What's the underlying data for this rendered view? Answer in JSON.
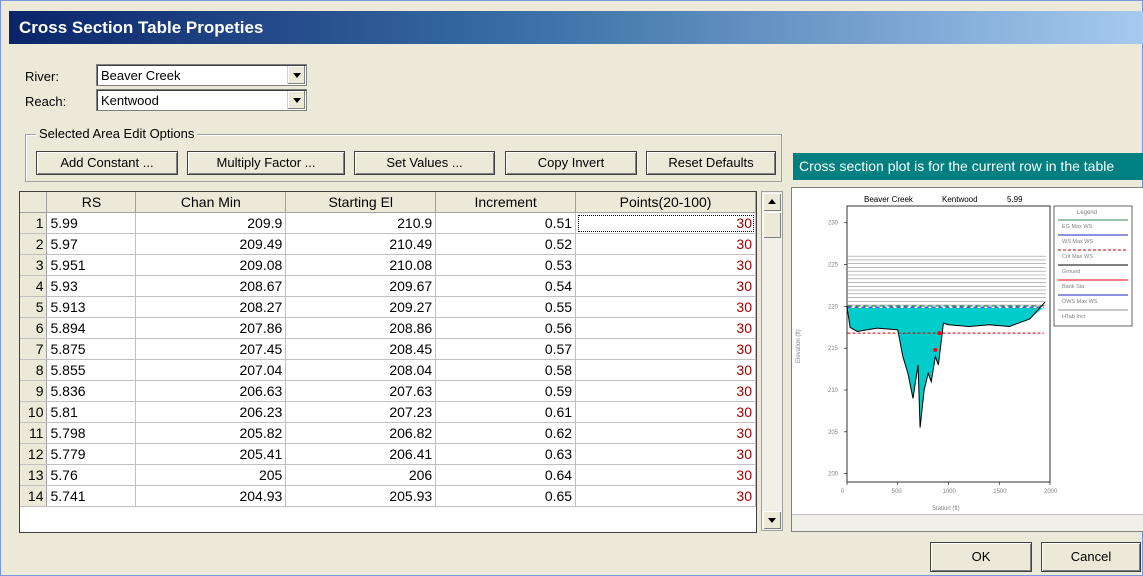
{
  "window": {
    "title": "Cross Section Table Propeties"
  },
  "river": {
    "label": "River:",
    "value": "Beaver Creek"
  },
  "reach": {
    "label": "Reach:",
    "value": "Kentwood"
  },
  "edit_options": {
    "legend": "Selected Area Edit Options",
    "buttons": [
      "Add Constant ...",
      "Multiply Factor ...",
      "Set Values ...",
      "Copy Invert",
      "Reset Defaults"
    ]
  },
  "info_text": "Cross section plot is for the current row in the table",
  "table": {
    "headers": [
      "RS",
      "Chan Min",
      "Starting El",
      "Increment",
      "Points(20-100)"
    ],
    "rows": [
      [
        "1",
        "5.99",
        "209.9",
        "210.9",
        "0.51",
        "30"
      ],
      [
        "2",
        "5.97",
        "209.49",
        "210.49",
        "0.52",
        "30"
      ],
      [
        "3",
        "5.951",
        "209.08",
        "210.08",
        "0.53",
        "30"
      ],
      [
        "4",
        "5.93",
        "208.67",
        "209.67",
        "0.54",
        "30"
      ],
      [
        "5",
        "5.913",
        "208.27",
        "209.27",
        "0.55",
        "30"
      ],
      [
        "6",
        "5.894",
        "207.86",
        "208.86",
        "0.56",
        "30"
      ],
      [
        "7",
        "5.875",
        "207.45",
        "208.45",
        "0.57",
        "30"
      ],
      [
        "8",
        "5.855",
        "207.04",
        "208.04",
        "0.58",
        "30"
      ],
      [
        "9",
        "5.836",
        "206.63",
        "207.63",
        "0.59",
        "30"
      ],
      [
        "10",
        "5.81",
        "206.23",
        "207.23",
        "0.61",
        "30"
      ],
      [
        "11",
        "5.798",
        "205.82",
        "206.82",
        "0.62",
        "30"
      ],
      [
        "12",
        "5.779",
        "205.41",
        "206.41",
        "0.63",
        "30"
      ],
      [
        "13",
        "5.76",
        "205",
        "206",
        "0.64",
        "30"
      ],
      [
        "14",
        "5.741",
        "204.93",
        "205.93",
        "0.65",
        "30"
      ]
    ]
  },
  "plot": {
    "title_river": "Beaver Creek",
    "title_reach": "Kentwood",
    "title_rs": "5.99",
    "ylabel": "Elevation (ft)",
    "xlabel": "Station (ft)",
    "yticks": [
      "230",
      "225",
      "220",
      "215",
      "210",
      "205",
      "200"
    ],
    "xticks": [
      "0",
      "500",
      "1000",
      "1500",
      "2000"
    ],
    "legend_title": "Legend",
    "legend_items": [
      "EG Max WS",
      "WS Max WS",
      "Crit Max WS",
      "Ground",
      "Bank Sta",
      "OWS Max WS",
      "HTab Incr"
    ],
    "colors": {
      "eg": "#2e8b57",
      "ws": "#2020c0",
      "crit": "#cc0000",
      "water": "#00cccc",
      "ground": "#000000",
      "bank": "#ff0000",
      "htab": "#909090"
    }
  },
  "dialog_buttons": {
    "ok": "OK",
    "cancel": "Cancel"
  }
}
